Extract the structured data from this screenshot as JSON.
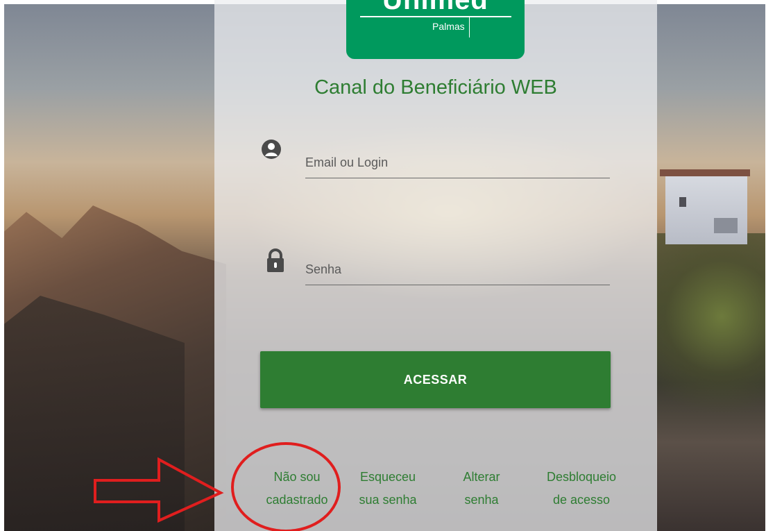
{
  "logo": {
    "brand": "Unimed",
    "unit": "Palmas"
  },
  "title": "Canal do Beneficiário WEB",
  "form": {
    "email_placeholder": "Email ou Login",
    "password_placeholder": "Senha",
    "submit_label": "ACESSAR"
  },
  "links": [
    {
      "line1": "Não sou",
      "line2": "cadastrado"
    },
    {
      "line1": "Esqueceu",
      "line2": "sua senha"
    },
    {
      "line1": "Alterar",
      "line2": "senha"
    },
    {
      "line1": "Desbloqueio",
      "line2": "de acesso"
    }
  ],
  "icons": {
    "user": "user-circle-icon",
    "lock": "lock-icon",
    "annotation_arrow": "arrow-right-icon",
    "annotation_circle": "circle-highlight-icon"
  },
  "colors": {
    "brand_green": "#00995d",
    "primary_green": "#2e7d32",
    "annotation_red": "#e01e1e"
  }
}
